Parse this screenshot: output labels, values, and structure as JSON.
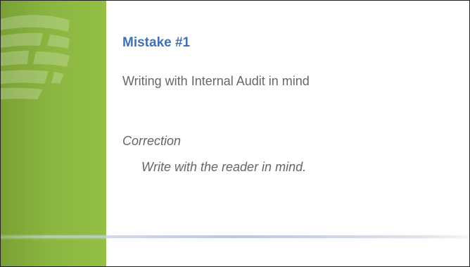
{
  "slide": {
    "title": "Mistake #1",
    "body": "Writing with Internal Audit in mind",
    "correction_label": "Correction",
    "correction_text": "Write with the reader in mind."
  },
  "colors": {
    "band_green": "#8ab540",
    "title_blue": "#3f72b4",
    "body_gray": "#666666",
    "border": "#222222"
  },
  "icons": {
    "logo": "globe-logo-icon"
  }
}
